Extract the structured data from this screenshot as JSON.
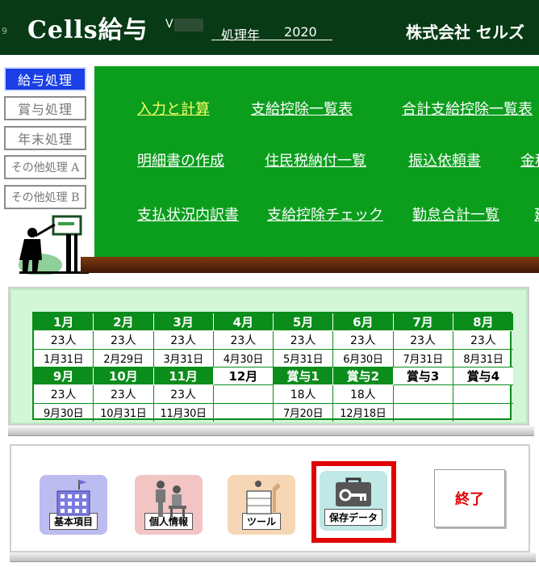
{
  "header": {
    "tiny_text": "9",
    "app_title": "Cells給与",
    "version_label": "V",
    "year_label": "処理年",
    "year_value": "2020",
    "company": "株式会社 セルズ"
  },
  "nav": {
    "items": [
      {
        "label": "給与処理",
        "active": true
      },
      {
        "label": "賞与処理",
        "active": false
      },
      {
        "label": "年末処理",
        "active": false
      },
      {
        "label": "その他処理 A",
        "active": false
      },
      {
        "label": "その他処理 B",
        "active": false
      }
    ]
  },
  "menu": {
    "rows": [
      [
        "入力と計算",
        "支給控除一覧表",
        "合計支給控除一覧表"
      ],
      [
        "明細書の作成",
        "住民税納付一覧",
        "振込依頼書",
        "金種"
      ],
      [
        "支払状況内訳書",
        "支給控除チェック",
        "勤怠合計一覧",
        "建"
      ]
    ]
  },
  "calendar": {
    "top_months": [
      "1月",
      "2月",
      "3月",
      "4月",
      "5月",
      "6月",
      "7月",
      "8月"
    ],
    "top_counts": [
      "23人",
      "23人",
      "23人",
      "23人",
      "23人",
      "23人",
      "23人",
      "23人"
    ],
    "top_dates": [
      "1月31日",
      "2月29日",
      "3月31日",
      "4月30日",
      "5月31日",
      "6月30日",
      "7月31日",
      "8月31日"
    ],
    "bottom_months": [
      "9月",
      "10月",
      "11月",
      "12月",
      "賞与1",
      "賞与2",
      "賞与3",
      "賞与4"
    ],
    "bottom_counts": [
      "23人",
      "23人",
      "23人",
      "",
      "18人",
      "18人",
      "",
      ""
    ],
    "bottom_dates": [
      "9月30日",
      "10月31日",
      "11月30日",
      "",
      "7月20日",
      "12月18日",
      "",
      ""
    ]
  },
  "tools": {
    "basic": "基本項目",
    "personal": "個人情報",
    "tool": "ツール",
    "save": "保存データ",
    "exit": "終了"
  },
  "colors": {
    "header_bg": "#083a16",
    "board_green": "#0b9e1d",
    "nav_active": "#1a3fe6",
    "highlight_yellow": "#ffff66",
    "save_frame": "#e00000"
  }
}
